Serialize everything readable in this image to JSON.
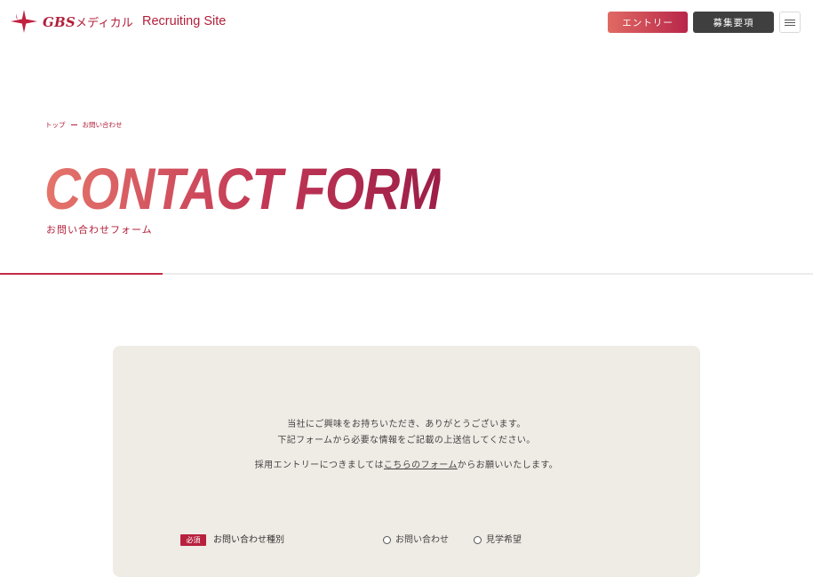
{
  "header": {
    "logo_brand": "GBS",
    "logo_brand_suffix": "メディカル",
    "logo_sub": "Recruiting Site",
    "entry_button": "エントリー",
    "recruit_button": "募集要項"
  },
  "breadcrumb": {
    "items": [
      "トップ",
      "お問い合わせ"
    ]
  },
  "hero": {
    "title": "CONTACT FORM",
    "subtitle": "お問い合わせフォーム"
  },
  "form": {
    "intro_line1": "当社にご興味をお持ちいただき、ありがとうございます。",
    "intro_line2": "下記フォームから必要な情報をご記載の上送信してください。",
    "intro_line3_pre": "採用エントリーにつきましては",
    "intro_line3_link": "こちらのフォーム",
    "intro_line3_post": "からお願いいたします。",
    "field": {
      "required_badge": "必須",
      "label": "お問い合わせ種別",
      "options": [
        "お問い合わせ",
        "見学希望"
      ]
    }
  },
  "colors": {
    "brand": "#b21f3a",
    "accent_gradient_start": "#e5756b",
    "accent_gradient_end": "#9c1e47",
    "panel_bg": "#efebe5"
  }
}
